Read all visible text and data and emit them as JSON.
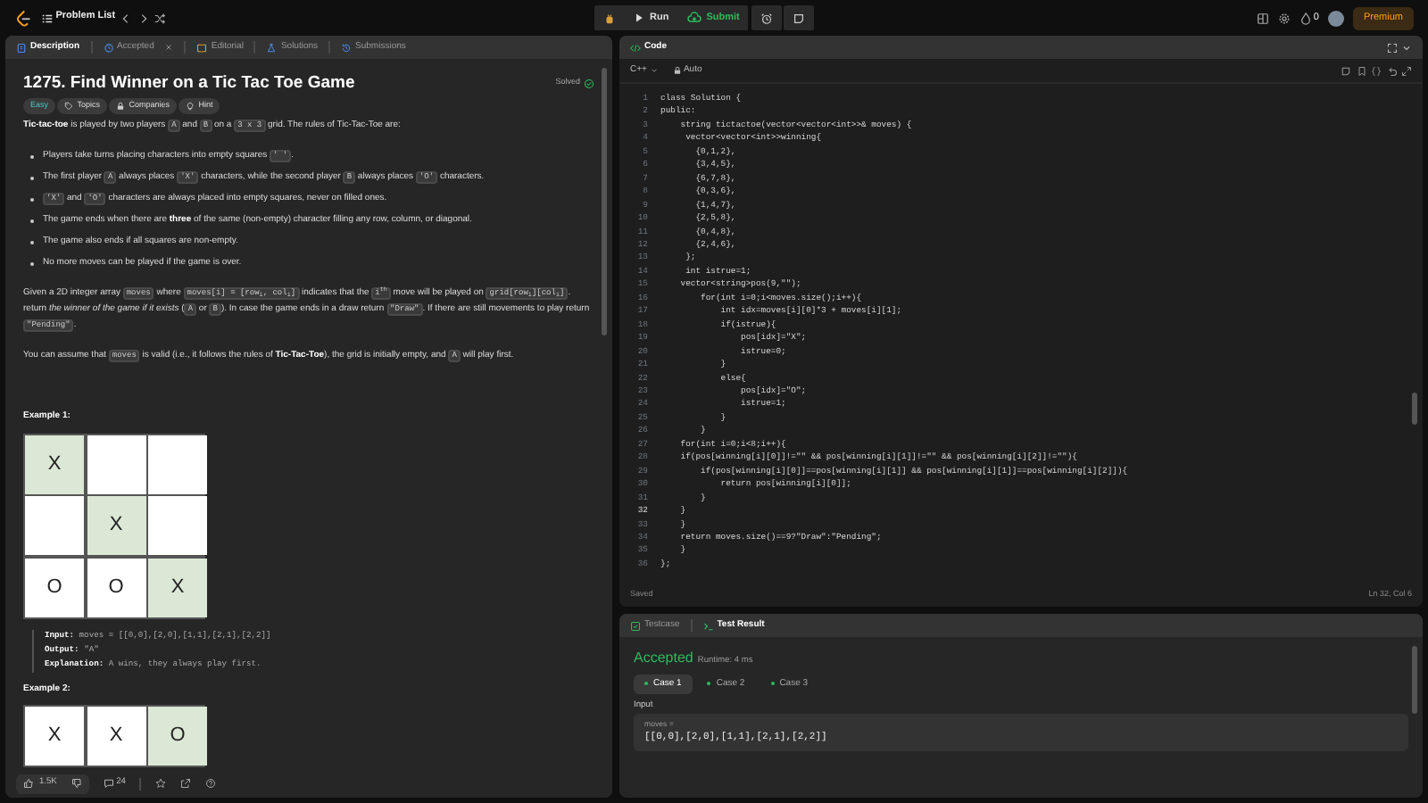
{
  "topbar": {
    "problem_list": "Problem List",
    "run": "Run",
    "submit": "Submit",
    "streak": "0",
    "premium": "Premium"
  },
  "description_panel": {
    "tabs": [
      {
        "kind": "description",
        "label": "Description",
        "selected": true,
        "closable": false
      },
      {
        "kind": "accepted",
        "label": "Accepted",
        "selected": false,
        "closable": true
      },
      {
        "kind": "editorial",
        "label": "Editorial",
        "selected": false,
        "closable": false
      },
      {
        "kind": "solutions",
        "label": "Solutions",
        "selected": false,
        "closable": false
      },
      {
        "kind": "submissions",
        "label": "Submissions",
        "selected": false,
        "closable": false
      }
    ],
    "title": "1275. Find Winner on a Tic Tac Toe Game",
    "status": "Solved",
    "tags": [
      {
        "kind": "difficulty",
        "label": "Easy"
      },
      {
        "kind": "topics",
        "label": "Topics"
      },
      {
        "kind": "companies",
        "label": "Companies"
      },
      {
        "kind": "hint",
        "label": "Hint"
      }
    ],
    "blocks": [
      {
        "kind": "paragraph",
        "segments": [
          {
            "kind": "text",
            "text": "**Tic-tac-toe** is played by two players "
          },
          {
            "kind": "code",
            "text": "A"
          },
          {
            "kind": "text",
            "text": " and "
          },
          {
            "kind": "code",
            "text": "B"
          },
          {
            "kind": "text",
            "text": " on a "
          },
          {
            "kind": "code",
            "text": "3 x 3"
          },
          {
            "kind": "text",
            "text": " grid. The rules of Tic-Tac-Toe are:"
          }
        ]
      },
      {
        "kind": "bullet",
        "segments": [
          {
            "kind": "text",
            "text": "Players take turns placing characters into empty squares "
          },
          {
            "kind": "code",
            "text": "' '"
          },
          {
            "kind": "text",
            "text": "."
          }
        ]
      },
      {
        "kind": "bullet",
        "segments": [
          {
            "kind": "text",
            "text": "The first player "
          },
          {
            "kind": "code",
            "text": "A"
          },
          {
            "kind": "text",
            "text": " always places "
          },
          {
            "kind": "code",
            "text": "'X'"
          },
          {
            "kind": "text",
            "text": " characters, while the second player "
          },
          {
            "kind": "code",
            "text": "B"
          },
          {
            "kind": "text",
            "text": " always places "
          },
          {
            "kind": "code",
            "text": "'O'"
          },
          {
            "kind": "text",
            "text": " characters."
          }
        ]
      },
      {
        "kind": "bullet",
        "segments": [
          {
            "kind": "code",
            "text": "'X'"
          },
          {
            "kind": "text",
            "text": " and "
          },
          {
            "kind": "code",
            "text": "'O'"
          },
          {
            "kind": "text",
            "text": " characters are always placed into empty squares, never on filled ones."
          }
        ]
      },
      {
        "kind": "bullet",
        "segments": [
          {
            "kind": "text",
            "text": "The game ends when there are **three** of the same (non-empty) character filling any row, column, or diagonal."
          }
        ]
      },
      {
        "kind": "bullet",
        "segments": [
          {
            "kind": "text",
            "text": "The game also ends if all squares are non-empty."
          }
        ]
      },
      {
        "kind": "bullet",
        "segments": [
          {
            "kind": "text",
            "text": "No more moves can be played if the game is over."
          }
        ]
      },
      {
        "kind": "paragraph",
        "segments": [
          {
            "kind": "text",
            "text": "Given a 2D integer array "
          },
          {
            "kind": "code",
            "text": "moves"
          },
          {
            "kind": "text",
            "text": " where "
          },
          {
            "kind": "code",
            "text": "moves[i] = [row$_{i}$, col$_{i}$]"
          },
          {
            "kind": "text",
            "text": " indicates that the "
          },
          {
            "kind": "code",
            "text": "i$^{th}$"
          },
          {
            "kind": "text",
            "text": " move will be played on "
          },
          {
            "kind": "code",
            "text": "grid[row$_{i}$][col$_{i}$]"
          },
          {
            "kind": "text",
            "text": ". return *the winner of the game if it exists* ("
          },
          {
            "kind": "code",
            "text": "A"
          },
          {
            "kind": "text",
            "text": " or "
          },
          {
            "kind": "code",
            "text": "B"
          },
          {
            "kind": "text",
            "text": "). In case the game ends in a draw return "
          },
          {
            "kind": "code",
            "text": "\"Draw\""
          },
          {
            "kind": "text",
            "text": ". If there are still movements to play return "
          },
          {
            "kind": "code",
            "text": "\"Pending\""
          },
          {
            "kind": "text",
            "text": "."
          }
        ]
      },
      {
        "kind": "paragraph",
        "segments": [
          {
            "kind": "text",
            "text": "You can assume that "
          },
          {
            "kind": "code",
            "text": "moves"
          },
          {
            "kind": "text",
            "text": " is valid (i.e., it follows the rules of **Tic-Tac-Toe**), the grid is initially empty, and "
          },
          {
            "kind": "code",
            "text": "A"
          },
          {
            "kind": "text",
            "text": " will play first."
          }
        ]
      }
    ],
    "examples": [
      {
        "heading": "Example 1:",
        "board": [
          {
            "mark": "X",
            "highlighted": true
          },
          {
            "highlighted": false
          },
          {
            "highlighted": false
          },
          {
            "highlighted": false
          },
          {
            "mark": "X",
            "highlighted": true
          },
          {
            "highlighted": false
          },
          {
            "mark": "O",
            "highlighted": false
          },
          {
            "mark": "O",
            "highlighted": false
          },
          {
            "mark": "X",
            "highlighted": true
          }
        ],
        "lines": [
          "**Input:** moves = [[0,0],[2,0],[1,1],[2,1],[2,2]]",
          "**Output:** \"A\"",
          "**Explanation:** A wins, they always play first."
        ]
      },
      {
        "heading": "Example 2:",
        "board": [
          {
            "mark": "X",
            "highlighted": false
          },
          {
            "mark": "X",
            "highlighted": false
          },
          {
            "mark": "O",
            "highlighted": true
          }
        ]
      }
    ],
    "footer": {
      "likes": "1.5K",
      "comments": "24"
    }
  },
  "code_panel": {
    "title": "Code",
    "language": "C++",
    "mode": "Auto",
    "lines": [
      {
        "n": "1",
        "code": "class Solution {",
        "current": false
      },
      {
        "n": "2",
        "code": "public:",
        "current": false
      },
      {
        "n": "3",
        "code": "    string tictactoe(vector<vector<int>>& moves) {",
        "current": false
      },
      {
        "n": "4",
        "code": "     vector<vector<int>>winning{",
        "current": false
      },
      {
        "n": "5",
        "code": "       {0,1,2},",
        "current": false
      },
      {
        "n": "6",
        "code": "       {3,4,5},",
        "current": false
      },
      {
        "n": "7",
        "code": "       {6,7,8},",
        "current": false
      },
      {
        "n": "8",
        "code": "       {0,3,6},",
        "current": false
      },
      {
        "n": "9",
        "code": "       {1,4,7},",
        "current": false
      },
      {
        "n": "10",
        "code": "       {2,5,8},",
        "current": false
      },
      {
        "n": "11",
        "code": "       {0,4,8},",
        "current": false
      },
      {
        "n": "12",
        "code": "       {2,4,6},",
        "current": false
      },
      {
        "n": "13",
        "code": "     };",
        "current": false
      },
      {
        "n": "14",
        "code": "     int istrue=1;",
        "current": false
      },
      {
        "n": "15",
        "code": "    vector<string>pos(9,\"\");",
        "current": false
      },
      {
        "n": "16",
        "code": "        for(int i=0;i<moves.size();i++){",
        "current": false
      },
      {
        "n": "17",
        "code": "            int idx=moves[i][0]*3 + moves[i][1];",
        "current": false
      },
      {
        "n": "18",
        "code": "            if(istrue){",
        "current": false
      },
      {
        "n": "19",
        "code": "                pos[idx]=\"X\";",
        "current": false
      },
      {
        "n": "20",
        "code": "                istrue=0;",
        "current": false
      },
      {
        "n": "21",
        "code": "            }",
        "current": false
      },
      {
        "n": "22",
        "code": "            else{",
        "current": false
      },
      {
        "n": "23",
        "code": "                pos[idx]=\"O\";",
        "current": false
      },
      {
        "n": "24",
        "code": "                istrue=1;",
        "current": false
      },
      {
        "n": "25",
        "code": "            }",
        "current": false
      },
      {
        "n": "26",
        "code": "        }",
        "current": false
      },
      {
        "n": "27",
        "code": "    for(int i=0;i<8;i++){",
        "current": false
      },
      {
        "n": "28",
        "code": "    if(pos[winning[i][0]]!=\"\" && pos[winning[i][1]]!=\"\" && pos[winning[i][2]]!=\"\"){",
        "current": false
      },
      {
        "n": "29",
        "code": "        if(pos[winning[i][0]]==pos[winning[i][1]] && pos[winning[i][1]]==pos[winning[i][2]]){",
        "current": false
      },
      {
        "n": "30",
        "code": "            return pos[winning[i][0]];",
        "current": false
      },
      {
        "n": "31",
        "code": "        }",
        "current": false
      },
      {
        "n": "32",
        "code": "    }",
        "current": true
      },
      {
        "n": "33",
        "code": "    }",
        "current": false
      },
      {
        "n": "34",
        "code": "    return moves.size()==9?\"Draw\":\"Pending\";",
        "current": false
      },
      {
        "n": "35",
        "code": "    }",
        "current": false
      },
      {
        "n": "36",
        "code": "};",
        "current": false
      }
    ],
    "status": "Saved",
    "cursor": "Ln 32, Col 6"
  },
  "result_panel": {
    "tabs": [
      {
        "kind": "testcase",
        "label": "Testcase",
        "selected": false
      },
      {
        "kind": "result",
        "label": "Test Result",
        "selected": true
      }
    ],
    "verdict": "Accepted",
    "runtime": "Runtime: 4 ms",
    "cases": [
      {
        "label": "Case 1",
        "selected": true,
        "passed": true
      },
      {
        "label": "Case 2",
        "selected": false,
        "passed": true
      },
      {
        "label": "Case 3",
        "selected": false,
        "passed": true
      }
    ],
    "input_label": "Input",
    "param": "moves =",
    "value": "[[0,0],[2,0],[1,1],[2,1],[2,2]]"
  }
}
